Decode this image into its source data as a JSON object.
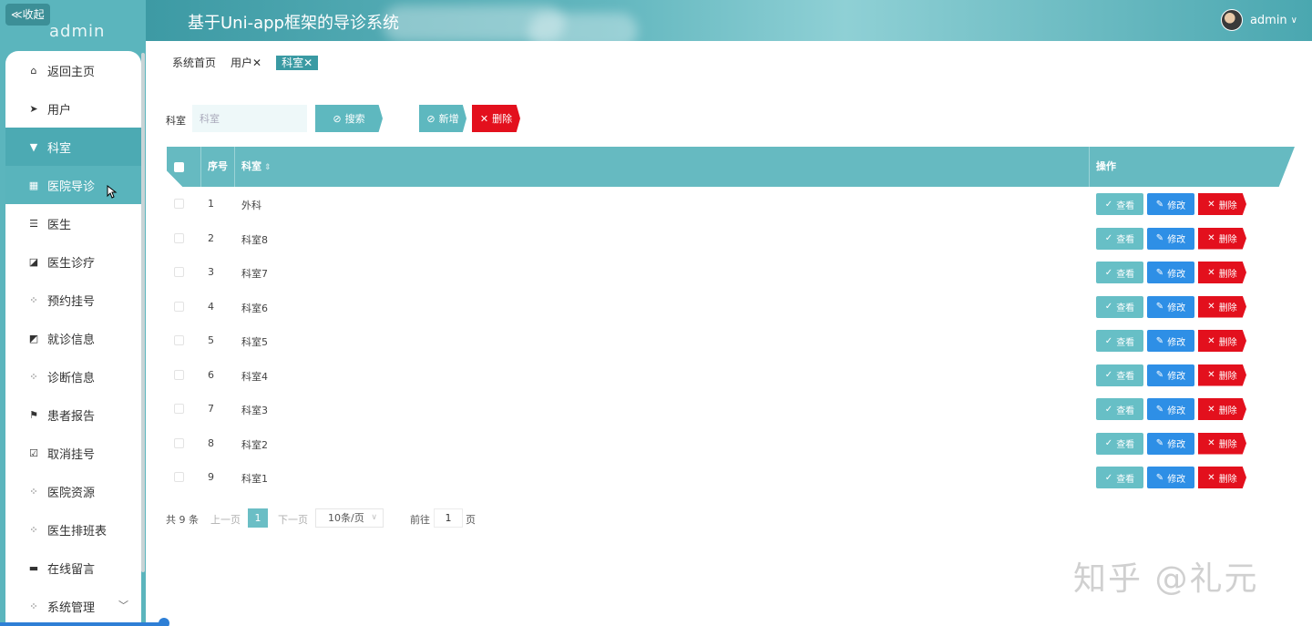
{
  "sidebar": {
    "collapse_label": "≪收起",
    "brand_name": "admin",
    "menu": [
      {
        "label": "返回主页",
        "icon": "home-icon"
      },
      {
        "label": "用户",
        "icon": "send-icon"
      },
      {
        "label": "科室",
        "icon": "filter-icon",
        "state": "active"
      },
      {
        "label": "医院导诊",
        "icon": "grid-icon",
        "state": "sub"
      },
      {
        "label": "医生",
        "icon": "list-icon"
      },
      {
        "label": "医生诊疗",
        "icon": "chart-icon"
      },
      {
        "label": "预约挂号",
        "icon": "apps-icon"
      },
      {
        "label": "就诊信息",
        "icon": "wallet-icon"
      },
      {
        "label": "诊断信息",
        "icon": "apps-icon"
      },
      {
        "label": "患者报告",
        "icon": "flag-icon"
      },
      {
        "label": "取消挂号",
        "icon": "clipboard-icon"
      },
      {
        "label": "医院资源",
        "icon": "apps-icon"
      },
      {
        "label": "医生排班表",
        "icon": "apps-icon"
      },
      {
        "label": "在线留言",
        "icon": "comment-icon"
      },
      {
        "label": "系统管理",
        "icon": "apps-icon"
      }
    ]
  },
  "header": {
    "title": "基于Uni-app框架的导诊系统",
    "user": "admin"
  },
  "tabs": [
    {
      "label": "系统首页"
    },
    {
      "label": "用户✕"
    },
    {
      "label": "科室✕",
      "active": true
    }
  ],
  "search": {
    "label": "科室",
    "placeholder": "科室",
    "value": "",
    "search_label": "搜索",
    "add_label": "新增",
    "delete_label": "删除"
  },
  "table": {
    "columns": {
      "index": "序号",
      "name": "科室",
      "ops": "操作"
    },
    "rows": [
      {
        "index": "1",
        "name": "外科"
      },
      {
        "index": "2",
        "name": "科室8"
      },
      {
        "index": "3",
        "name": "科室7"
      },
      {
        "index": "4",
        "name": "科室6"
      },
      {
        "index": "5",
        "name": "科室5"
      },
      {
        "index": "6",
        "name": "科室4"
      },
      {
        "index": "7",
        "name": "科室3"
      },
      {
        "index": "8",
        "name": "科室2"
      },
      {
        "index": "9",
        "name": "科室1"
      }
    ],
    "op_labels": {
      "view": "查看",
      "edit": "修改",
      "delete": "删除"
    }
  },
  "pagination": {
    "total": "共 9 条",
    "prev": "上一页",
    "current_page": "1",
    "next": "下一页",
    "page_size": "10条/页",
    "goto_label": "前往",
    "goto_value": "1",
    "page_unit": "页"
  },
  "watermark": "知乎 @礼元",
  "colors": {
    "accent": "#5bb5bd",
    "danger": "#e3101d",
    "edit": "#2e8fe6"
  }
}
